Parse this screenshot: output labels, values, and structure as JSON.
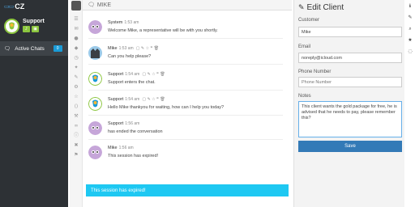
{
  "brand": {
    "text": "CZ"
  },
  "agent": {
    "name": "Support"
  },
  "sidebar": {
    "active_chats_label": "Active Chats",
    "active_chats_count": "0"
  },
  "chat": {
    "header_name": "MIKE",
    "messages": [
      {
        "author": "System",
        "time": "1:53 am",
        "text": "Welcome Mike, a representative will be with you shortly."
      },
      {
        "author": "Mike",
        "time": "1:53 am",
        "text": "Can you help please?"
      },
      {
        "author": "Support",
        "time": "1:54 am",
        "text": "Support enters the chat."
      },
      {
        "author": "Support",
        "time": "1:54 am",
        "text": "Hello Mike thankyou for waiting, how can I help you today?"
      },
      {
        "author": "Support",
        "time": "1:56 am",
        "text": "has ended the conversation"
      },
      {
        "author": "Mike",
        "time": "1:56 am",
        "text": "This session has expired!"
      }
    ],
    "expired_banner": "This session has expired!"
  },
  "form": {
    "title": "Edit Client",
    "customer_label": "Customer",
    "customer_value": "Mike",
    "email_label": "Email",
    "email_value": "noreply@icloud.com",
    "phone_label": "Phone Number",
    "phone_placeholder": "Phone Number",
    "notes_label": "Notes",
    "notes_value": "This client wants the gold package for free, he is advised that he needs to pay, please remember this?",
    "save_label": "Save"
  },
  "colors": {
    "accent": "#1a9bd7",
    "banner": "#1ec8f2",
    "agent_green": "#8cc63f",
    "save": "#337ab7",
    "dark_panel": "#2d3135"
  }
}
